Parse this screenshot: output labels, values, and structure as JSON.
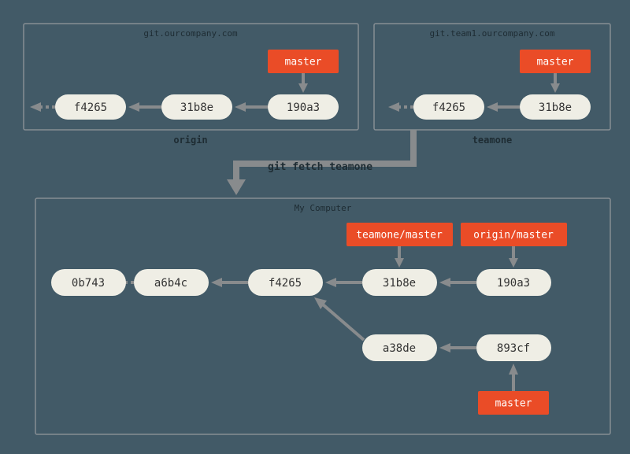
{
  "origin_panel": {
    "host": "git.ourcompany.com",
    "caption": "origin",
    "ref_master": "master",
    "commits": [
      "f4265",
      "31b8e",
      "190a3"
    ]
  },
  "teamone_panel": {
    "host": "git.team1.ourcompany.com",
    "caption": "teamone",
    "ref_master": "master",
    "commits": [
      "f4265",
      "31b8e"
    ]
  },
  "fetch_command": "git fetch teamone",
  "local_panel": {
    "title": "My Computer",
    "ref_teamone": "teamone/master",
    "ref_origin": "origin/master",
    "ref_master": "master",
    "row1": [
      "0b743",
      "a6b4c",
      "f4265",
      "31b8e",
      "190a3"
    ],
    "row2": [
      "a38de",
      "893cf"
    ]
  }
}
